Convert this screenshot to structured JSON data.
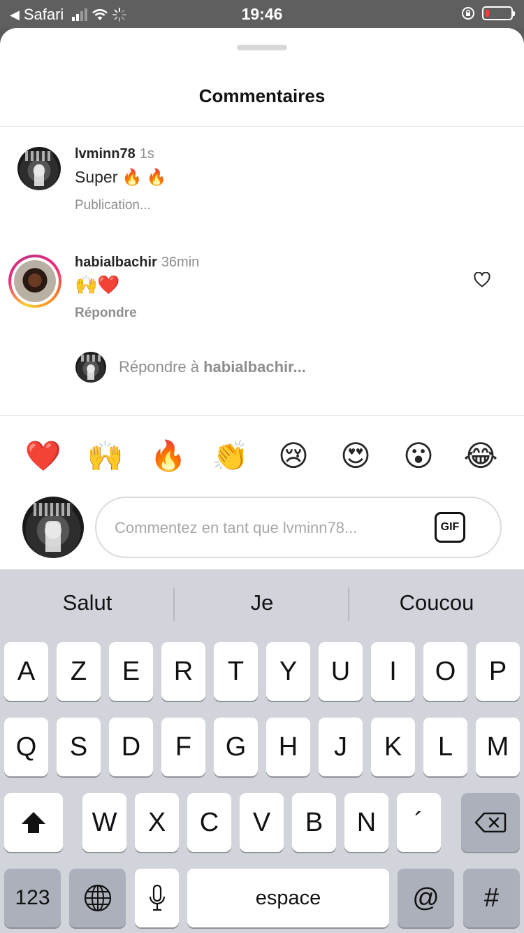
{
  "status_bar": {
    "back_app": "Safari",
    "time": "19:46"
  },
  "sheet": {
    "title": "Commentaires"
  },
  "comments": [
    {
      "username": "lvminn78",
      "time_ago": "1s",
      "text": "Super 🔥 🔥",
      "meta": "Publication..."
    },
    {
      "username": "habialbachir",
      "time_ago": "36min",
      "text": "🙌❤️",
      "meta": "Répondre"
    }
  ],
  "reply_prompt": {
    "prefix": "Répondre à ",
    "target": "habialbachir..."
  },
  "quick_emojis": [
    "❤️",
    "🙌",
    "🔥",
    "👏",
    "😢",
    "😍",
    "😮",
    "😂"
  ],
  "composer": {
    "placeholder": "Commentez en tant que lvminn78...",
    "gif_label": "GIF"
  },
  "keyboard": {
    "suggestions": [
      "Salut",
      "Je",
      "Coucou"
    ],
    "row1": [
      "A",
      "Z",
      "E",
      "R",
      "T",
      "Y",
      "U",
      "I",
      "O",
      "P"
    ],
    "row2": [
      "Q",
      "S",
      "D",
      "F",
      "G",
      "H",
      "J",
      "K",
      "L",
      "M"
    ],
    "row3": [
      "W",
      "X",
      "C",
      "V",
      "B",
      "N",
      "´"
    ],
    "numbers_label": "123",
    "space_label": "espace",
    "at_label": "@",
    "hash_label": "#"
  },
  "icons": {
    "heart": "heart-outline-icon",
    "shift": "shift-arrow-icon",
    "backspace": "backspace-icon",
    "globe": "globe-icon",
    "mic": "microphone-icon"
  }
}
